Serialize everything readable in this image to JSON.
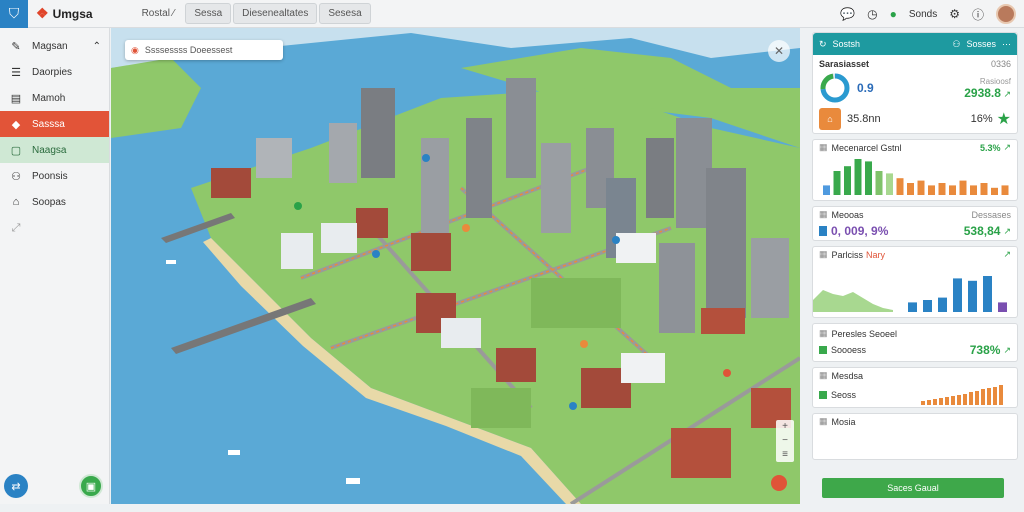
{
  "app": {
    "brand": "Umgsa",
    "logo_icon": "shield-icon"
  },
  "tabs": [
    {
      "label": "Rostal ⁄"
    },
    {
      "label": "Sessa"
    },
    {
      "label": "Diesenealtates"
    },
    {
      "label": "Sesesa"
    }
  ],
  "topbar": {
    "user_status": "Sonds"
  },
  "sidebar": {
    "items": [
      {
        "label": "Magsan",
        "icon": "pencil-icon"
      },
      {
        "label": "Daorpies",
        "icon": "list-icon"
      },
      {
        "label": "Mamoh",
        "icon": "book-icon"
      },
      {
        "label": "Sasssa",
        "icon": "tag-icon"
      },
      {
        "label": "Naagsa",
        "icon": "chat-icon"
      },
      {
        "label": "Poonsis",
        "icon": "user-icon"
      },
      {
        "label": "Soopas",
        "icon": "home-icon"
      }
    ]
  },
  "map": {
    "search_placeholder": "Ssssessss Doeessest",
    "colors": {
      "water": "#5aa9d6",
      "land": "#8fc86a",
      "road": "#9a9a9a"
    }
  },
  "panel": {
    "header": {
      "left": "Sostsh",
      "right": "Sosses"
    },
    "summary": {
      "title": "Sarasiasset",
      "top_right": "0336",
      "donut_value": "0.9",
      "trend_label": "Rasioosf",
      "trend_value": "2938.8",
      "store_value": "35.8nn",
      "store_percent": "16%"
    },
    "chart1": {
      "title": "Mecenarcel Gstnl",
      "value": "5.3%"
    },
    "stats": {
      "title": "Meooas",
      "right_label": "Dessases",
      "left_value": "0, 009, 9%",
      "right_value": "538,84"
    },
    "chart2": {
      "title": "Parlciss",
      "tag": "Nary"
    },
    "rows": [
      {
        "label": "Peresles Seoeel",
        "value": ""
      },
      {
        "label": "Soooess",
        "value": "738%"
      },
      {
        "label": "Mesdsa",
        "value": ""
      },
      {
        "label": "Seoss",
        "value": ""
      },
      {
        "label": "Mosia",
        "value": ""
      }
    ],
    "button_label": "Saces Gaual"
  },
  "chart_data": [
    {
      "type": "bar",
      "categories": [
        "1",
        "2",
        "3",
        "4",
        "5",
        "6",
        "7",
        "8",
        "9",
        "10",
        "11",
        "12",
        "13",
        "14",
        "15",
        "16",
        "17",
        "18"
      ],
      "values": [
        8,
        20,
        24,
        30,
        28,
        20,
        18,
        14,
        10,
        12,
        8,
        10,
        8,
        12,
        8,
        10,
        6,
        8
      ]
    },
    {
      "type": "bar",
      "categories": [
        "1",
        "2",
        "3",
        "4",
        "5",
        "6",
        "7"
      ],
      "values": [
        8,
        10,
        12,
        28,
        26,
        30,
        8
      ]
    }
  ]
}
